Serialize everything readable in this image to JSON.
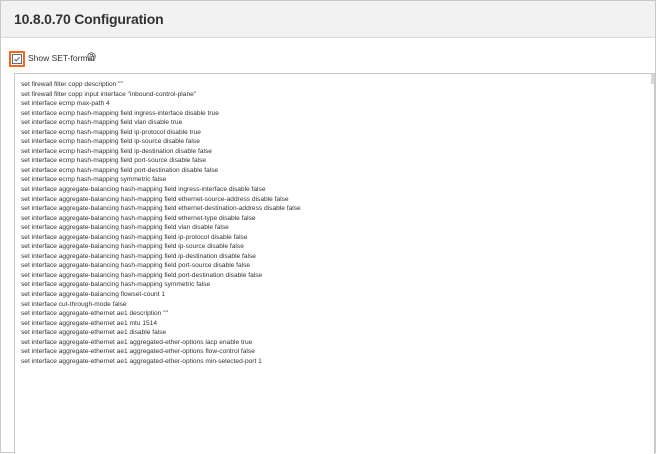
{
  "page": {
    "title": "10.8.0.70 Configuration"
  },
  "toolbar": {
    "show_set_format_label": "Show SET-format",
    "show_set_format_checked": true,
    "help_icon": "help-circle-icon",
    "highlight_color": "#f26522"
  },
  "config": {
    "lines": [
      "set firewall filter copp description \"\"",
      "set firewall filter copp input interface \"inbound-control-plane\"",
      "set interface ecmp max-path 4",
      "set interface ecmp hash-mapping field ingress-interface disable true",
      "set interface ecmp hash-mapping field vlan disable true",
      "set interface ecmp hash-mapping field ip-protocol disable true",
      "set interface ecmp hash-mapping field ip-source disable false",
      "set interface ecmp hash-mapping field ip-destination disable false",
      "set interface ecmp hash-mapping field port-source disable false",
      "set interface ecmp hash-mapping field port-destination disable false",
      "set interface ecmp hash-mapping symmetric false",
      "set interface aggregate-balancing hash-mapping field ingress-interface disable false",
      "set interface aggregate-balancing hash-mapping field ethernet-source-address disable false",
      "set interface aggregate-balancing hash-mapping field ethernet-destination-address disable false",
      "set interface aggregate-balancing hash-mapping field ethernet-type disable false",
      "set interface aggregate-balancing hash-mapping field vlan disable false",
      "set interface aggregate-balancing hash-mapping field ip-protocol disable false",
      "set interface aggregate-balancing hash-mapping field ip-source disable false",
      "set interface aggregate-balancing hash-mapping field ip-destination disable false",
      "set interface aggregate-balancing hash-mapping field port-source disable false",
      "set interface aggregate-balancing hash-mapping field port-destination disable false",
      "set interface aggregate-balancing hash-mapping symmetric false",
      "set interface aggregate-balancing flowset-count 1",
      "set interface cut-through-mode false",
      "set interface aggregate-ethernet ae1 description \"\"",
      "set interface aggregate-ethernet ae1 mtu 1514",
      "set interface aggregate-ethernet ae1 disable false",
      "set interface aggregate-ethernet ae1 aggregated-ether-options lacp enable true",
      "set interface aggregate-ethernet ae1 aggregated-ether-options flow-control false",
      "set interface aggregate-ethernet ae1 aggregated-ether-options min-selected-port 1"
    ]
  }
}
